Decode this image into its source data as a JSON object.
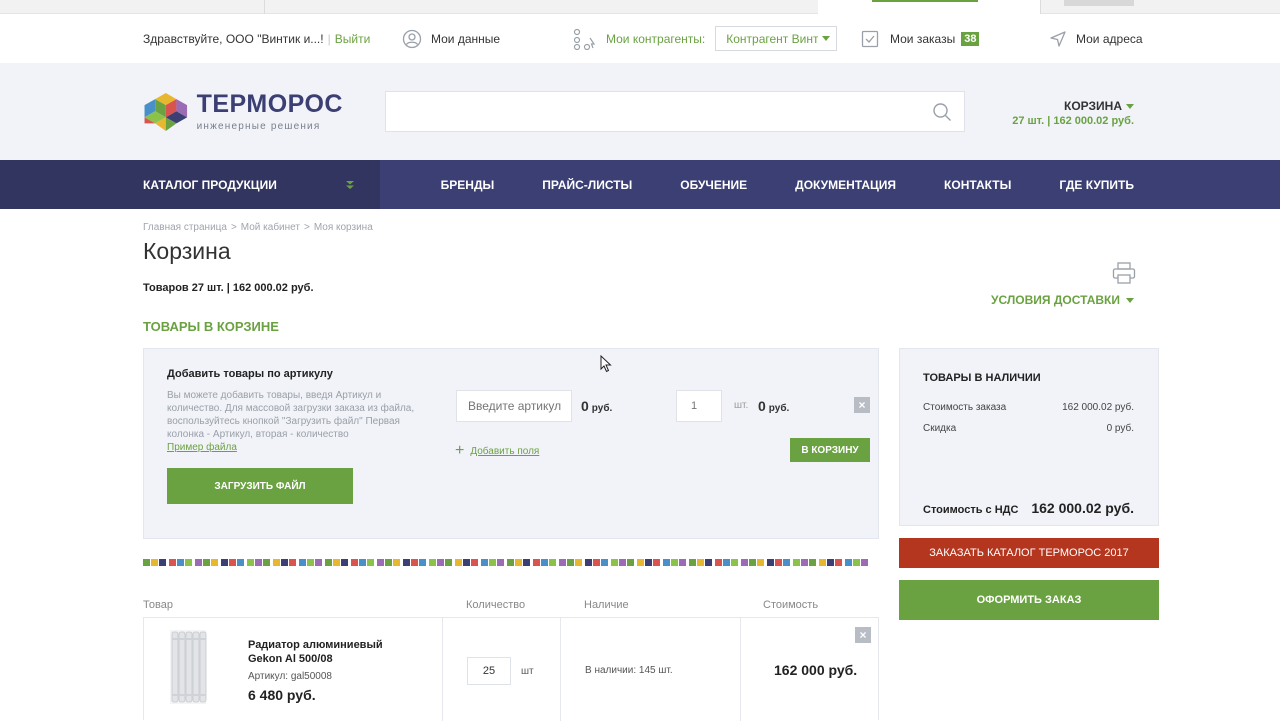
{
  "userbar": {
    "greeting": "Здравствуйте, ООО \"Винтик и...!",
    "logout": "Выйти",
    "my_data": "Мои данные",
    "contractors_label": "Мои контрагенты:",
    "contractor_selected": "Контрагент Винтик и Шпунтик",
    "my_orders": "Мои заказы",
    "orders_count": "38",
    "my_addresses": "Мои адреса"
  },
  "header": {
    "logo_name": "ТЕРМОРОС",
    "logo_sub": "инженерные решения",
    "search_placeholder": "",
    "cart_title": "КОРЗИНА",
    "cart_summary": "27 шт. | 162 000.02 руб."
  },
  "nav": {
    "catalog": "КАТАЛОГ ПРОДУКЦИИ",
    "items": [
      "БРЕНДЫ",
      "ПРАЙС-ЛИСТЫ",
      "ОБУЧЕНИЕ",
      "ДОКУМЕНТАЦИЯ",
      "КОНТАКТЫ",
      "ГДЕ КУПИТЬ"
    ]
  },
  "breadcrumbs": [
    "Главная страница",
    "Мой кабинет",
    "Моя корзина"
  ],
  "breadcrumb_sep": ">",
  "page": {
    "title": "Корзина",
    "summary": "Товаров 27 шт. | 162 000.02 руб.",
    "delivery": "УСЛОВИЯ ДОСТАВКИ",
    "section_title": "ТОВАРЫ В КОРЗИНЕ"
  },
  "add_box": {
    "heading": "Добавить товары по артикулу",
    "description": "Вы можете добавить товары, введя Артикул и количество. Для массовой загрузки заказа из файла, воспользуйтесь кнопкой \"Загрузить файл\" Первая колонка - Артикул, вторая - количество",
    "file_example": "Пример файла",
    "upload_button": "ЗАГРУЗИТЬ ФАЙЛ",
    "article_placeholder": "Введите артикул",
    "price_value": "0",
    "currency": "руб.",
    "qty_value": "1",
    "pcs": "шт.",
    "sum_value": "0",
    "add_fields": "Добавить поля",
    "to_cart": "В КОРЗИНУ",
    "close": "×"
  },
  "table": {
    "headers": [
      "Товар",
      "Количество",
      "Наличие",
      "Стоимость"
    ],
    "rows": [
      {
        "name": "Радиатор алюминиевый Gekon Al 500/08",
        "article": "Артикул: gal50008",
        "unit_price": "6 480 руб.",
        "qty": "25",
        "pcs": "шт",
        "stock": "В наличии: 145 шт.",
        "total": "162 000 руб.",
        "close": "×"
      }
    ]
  },
  "side": {
    "heading": "ТОВАРЫ В НАЛИЧИИ",
    "order_cost_label": "Стоимость заказа",
    "order_cost_value": "162 000.02 руб.",
    "discount_label": "Скидка",
    "discount_value": "0 руб.",
    "vat_label": "Стоимость с НДС",
    "vat_value": "162 000.02 руб.",
    "catalog_button": "ЗАКАЗАТЬ КАТАЛОГ ТЕРМОРОС 2017",
    "order_button": "ОФОРМИТЬ ЗАКАЗ"
  },
  "colors": {
    "brand_navy": "#3b3f73",
    "accent_green": "#6aa242",
    "alert_red": "#b5361f",
    "panel_bg": "#f1f3f8"
  },
  "mosaic_colors": [
    "#6aa242",
    "#e8b730",
    "#3b3f73",
    "#d9534f",
    "#4a90c8",
    "#8bc34a",
    "#9b6bb5"
  ]
}
